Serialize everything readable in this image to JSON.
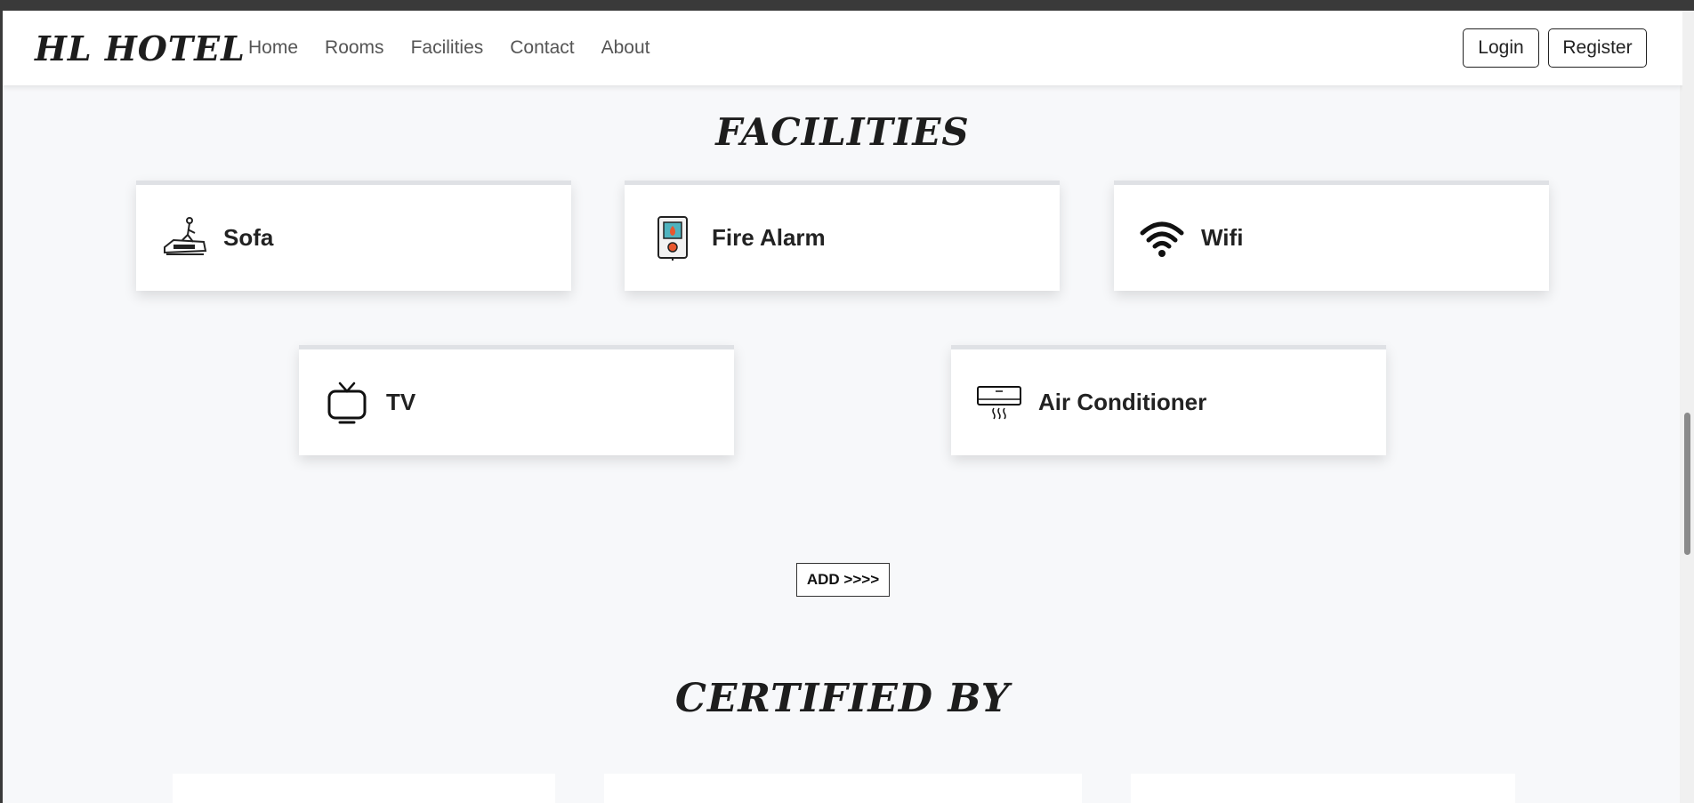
{
  "brand": "HL HOTEL",
  "nav": [
    "Home",
    "Rooms",
    "Facilities",
    "Contact",
    "About"
  ],
  "auth": {
    "login": "Login",
    "register": "Register"
  },
  "facilities_title": "FACILITIES",
  "facilities": [
    {
      "label": "Sofa",
      "icon": "sofa-icon"
    },
    {
      "label": "Fire Alarm",
      "icon": "fire-alarm-icon"
    },
    {
      "label": "Wifi",
      "icon": "wifi-icon"
    },
    {
      "label": "TV",
      "icon": "tv-icon"
    },
    {
      "label": "Air Conditioner",
      "icon": "air-conditioner-icon"
    }
  ],
  "add_button": "ADD >>>>",
  "certified_title": "CERTIFIED BY",
  "colors": {
    "page_bg": "#f7f8fa",
    "card_bg": "#ffffff",
    "text": "#1d1d1d"
  }
}
